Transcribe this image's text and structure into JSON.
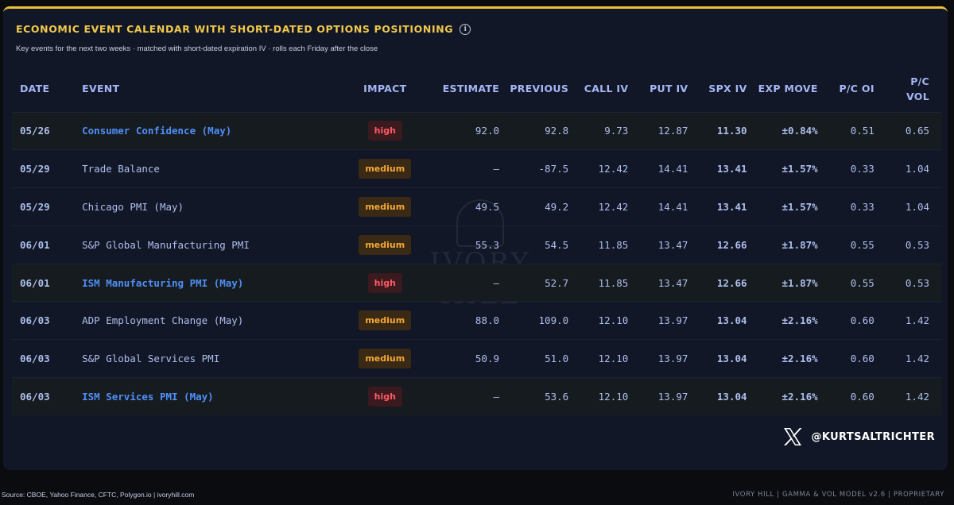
{
  "header": {
    "title": "ECONOMIC EVENT CALENDAR WITH SHORT-DATED OPTIONS POSITIONING",
    "info_icon": "info-icon",
    "subtitle": "Key events for the next two weeks · matched with short-dated expiration IV · rolls each Friday after the close"
  },
  "table": {
    "columns": {
      "date": "DATE",
      "event": "EVENT",
      "impact": "IMPACT",
      "estimate": "ESTIMATE",
      "previous": "PREVIOUS",
      "call_iv": "CALL IV",
      "put_iv": "PUT IV",
      "spx_iv": "SPX IV",
      "exp_move": "EXP MOVE",
      "pc_oi": "P/C OI",
      "pc_vol_1": "P/C",
      "pc_vol_2": "VOL"
    },
    "rows": [
      {
        "date": "05/26",
        "event": "Consumer Confidence (May)",
        "impact": "high",
        "estimate": "92.0",
        "previous": "92.8",
        "call_iv": "9.73",
        "put_iv": "12.87",
        "spx_iv": "11.30",
        "exp_move": "±0.84%",
        "pc_oi": "0.51",
        "pc_vol": "0.65"
      },
      {
        "date": "05/29",
        "event": "Trade Balance",
        "impact": "medium",
        "estimate": "—",
        "previous": "-87.5",
        "call_iv": "12.42",
        "put_iv": "14.41",
        "spx_iv": "13.41",
        "exp_move": "±1.57%",
        "pc_oi": "0.33",
        "pc_vol": "1.04"
      },
      {
        "date": "05/29",
        "event": "Chicago PMI (May)",
        "impact": "medium",
        "estimate": "49.5",
        "previous": "49.2",
        "call_iv": "12.42",
        "put_iv": "14.41",
        "spx_iv": "13.41",
        "exp_move": "±1.57%",
        "pc_oi": "0.33",
        "pc_vol": "1.04"
      },
      {
        "date": "06/01",
        "event": "S&P Global Manufacturing PMI",
        "impact": "medium",
        "estimate": "55.3",
        "previous": "54.5",
        "call_iv": "11.85",
        "put_iv": "13.47",
        "spx_iv": "12.66",
        "exp_move": "±1.87%",
        "pc_oi": "0.55",
        "pc_vol": "0.53"
      },
      {
        "date": "06/01",
        "event": "ISM Manufacturing PMI (May)",
        "impact": "high",
        "estimate": "—",
        "previous": "52.7",
        "call_iv": "11.85",
        "put_iv": "13.47",
        "spx_iv": "12.66",
        "exp_move": "±1.87%",
        "pc_oi": "0.55",
        "pc_vol": "0.53"
      },
      {
        "date": "06/03",
        "event": "ADP Employment Change (May)",
        "impact": "medium",
        "estimate": "88.0",
        "previous": "109.0",
        "call_iv": "12.10",
        "put_iv": "13.97",
        "spx_iv": "13.04",
        "exp_move": "±2.16%",
        "pc_oi": "0.60",
        "pc_vol": "1.42"
      },
      {
        "date": "06/03",
        "event": "S&P Global Services PMI",
        "impact": "medium",
        "estimate": "50.9",
        "previous": "51.0",
        "call_iv": "12.10",
        "put_iv": "13.97",
        "spx_iv": "13.04",
        "exp_move": "±2.16%",
        "pc_oi": "0.60",
        "pc_vol": "1.42"
      },
      {
        "date": "06/03",
        "event": "ISM Services PMI (May)",
        "impact": "high",
        "estimate": "—",
        "previous": "53.6",
        "call_iv": "12.10",
        "put_iv": "13.97",
        "spx_iv": "13.04",
        "exp_move": "±2.16%",
        "pc_oi": "0.60",
        "pc_vol": "1.42"
      }
    ]
  },
  "watermark": {
    "text": "IVORY HILL"
  },
  "brand": {
    "icon": "x-logo-icon",
    "handle": "@KURTSALTRICHTER"
  },
  "footer": {
    "source": "Source: CBOE, Yahoo Finance, CFTC, Polygon.io | ivoryhill.com",
    "model": "IVORY HILL | GAMMA & VOL MODEL v2.6 | PROPRIETARY"
  },
  "colors": {
    "accent": "#f2c94c",
    "high_text": "#ff5a64",
    "medium_text": "#f4a937",
    "event_high": "#4f8ef7",
    "background": "#111726"
  }
}
